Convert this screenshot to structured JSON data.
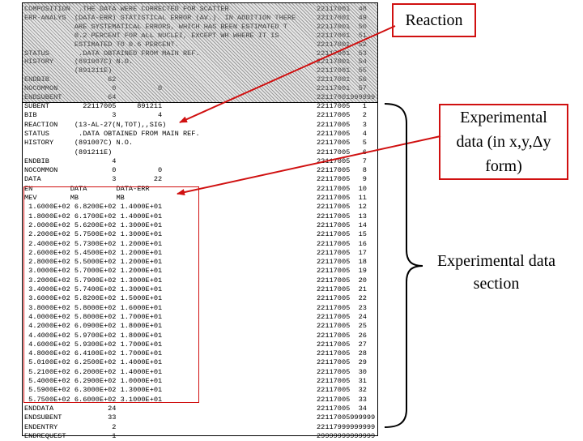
{
  "header_lines": [
    {
      "text": "COMPOSITION  .THE DATA WERE CORRECTED FOR SCATTER",
      "tag": "22117001  48"
    },
    {
      "text": "ERR-ANALYS  (DATA-ERR) STATISTICAL ERROR (AV.). IN ADDITION THERE",
      "tag": "22117001  49"
    },
    {
      "text": "            ARE SYSTEMATICAL ERRORS, WHICH HAS BEEN ESTIMATED T",
      "tag": "22117001  50"
    },
    {
      "text": "            0.2 PERCENT FOR ALL NUCLEI, EXCEPT WH WHERE IT IS",
      "tag": "22117001  51"
    },
    {
      "text": "            ESTIMATED TO 0.6 PERCENT.",
      "tag": "22117001  52"
    },
    {
      "text": "STATUS       .DATA OBTAINED FROM MAIN REF.",
      "tag": "22117001  53"
    },
    {
      "text": "HISTORY     (891007C) N.O.",
      "tag": "22117001  54"
    },
    {
      "text": "            (891211E)",
      "tag": "22117001  55"
    },
    {
      "text": "ENDBIB              62",
      "tag": "22117001  56"
    },
    {
      "text": "NOCOMMON             0          0",
      "tag": "22117001  57"
    },
    {
      "text": "ENDSUBENT           64",
      "tag": "22117001999999"
    }
  ],
  "body_lines": [
    {
      "text": "SUBENT        22117005     891211",
      "tag": "22117005   1"
    },
    {
      "text": "BIB                  3          4",
      "tag": "22117005   2"
    },
    {
      "text": "REACTION    (13-AL-27(N,TOT),,SIG)",
      "tag": "22117005   3"
    },
    {
      "text": "STATUS       .DATA OBTAINED FROM MAIN REF.",
      "tag": "22117005   4"
    },
    {
      "text": "HISTORY     (891007C) N.O.",
      "tag": "22117005   5"
    },
    {
      "text": "            (891211E)",
      "tag": "22117005   6"
    },
    {
      "text": "ENDBIB               4",
      "tag": "22117005   7"
    },
    {
      "text": "NOCOMMON             0          0",
      "tag": "22117005   8"
    },
    {
      "text": "DATA                 3         22",
      "tag": "22117005   9"
    },
    {
      "text": "EN         DATA       DATA-ERR",
      "tag": "22117005  10"
    },
    {
      "text": "MEV        MB         MB",
      "tag": "22117005  11"
    },
    {
      "text": " 1.6000E+02 6.8200E+02 1.4000E+01",
      "tag": "22117005  12"
    },
    {
      "text": " 1.8000E+02 6.1700E+02 1.4000E+01",
      "tag": "22117005  13"
    },
    {
      "text": " 2.0000E+02 5.6200E+02 1.3000E+01",
      "tag": "22117005  14"
    },
    {
      "text": " 2.2000E+02 5.7500E+02 1.3000E+01",
      "tag": "22117005  15"
    },
    {
      "text": " 2.4000E+02 5.7300E+02 1.2000E+01",
      "tag": "22117005  16"
    },
    {
      "text": " 2.6000E+02 5.4500E+02 1.2000E+01",
      "tag": "22117005  17"
    },
    {
      "text": " 2.8000E+02 5.5000E+02 1.2000E+01",
      "tag": "22117005  18"
    },
    {
      "text": " 3.0000E+02 5.7000E+02 1.2000E+01",
      "tag": "22117005  19"
    },
    {
      "text": " 3.2000E+02 5.7900E+02 1.3000E+01",
      "tag": "22117005  20"
    },
    {
      "text": " 3.4000E+02 5.7400E+02 1.3000E+01",
      "tag": "22117005  21"
    },
    {
      "text": " 3.6000E+02 5.8200E+02 1.5000E+01",
      "tag": "22117005  22"
    },
    {
      "text": " 3.8000E+02 5.8000E+02 1.6000E+01",
      "tag": "22117005  23"
    },
    {
      "text": " 4.0000E+02 5.8000E+02 1.7000E+01",
      "tag": "22117005  24"
    },
    {
      "text": " 4.2000E+02 6.0900E+02 1.8000E+01",
      "tag": "22117005  25"
    },
    {
      "text": " 4.4000E+02 5.9700E+02 1.8000E+01",
      "tag": "22117005  26"
    },
    {
      "text": " 4.6000E+02 5.9300E+02 1.7000E+01",
      "tag": "22117005  27"
    },
    {
      "text": " 4.8000E+02 6.4100E+02 1.7000E+01",
      "tag": "22117005  28"
    },
    {
      "text": " 5.0100E+02 6.2500E+02 1.4000E+01",
      "tag": "22117005  29"
    },
    {
      "text": " 5.2100E+02 6.2000E+02 1.4000E+01",
      "tag": "22117005  30"
    },
    {
      "text": " 5.4000E+02 6.2900E+02 1.0000E+01",
      "tag": "22117005  31"
    },
    {
      "text": " 5.5900E+02 6.3000E+02 1.3000E+01",
      "tag": "22117005  32"
    },
    {
      "text": " 5.7500E+02 6.6000E+02 3.1000E+01",
      "tag": "22117005  33"
    },
    {
      "text": "ENDDATA             24",
      "tag": "22117005  34"
    },
    {
      "text": "ENDSUBENT           33",
      "tag": "22117005999999"
    },
    {
      "text": "ENDENTRY             2",
      "tag": "22117999999999"
    },
    {
      "text": "ENDREQUEST           1",
      "tag": "29999999999999"
    }
  ],
  "annotations": {
    "reaction_label": "Reaction",
    "experimental_data_label": "Experimental data (in x,y,Δy form)",
    "experimental_section_label": "Experimental data section"
  },
  "colors": {
    "annotation_red": "#d01010",
    "text": "#000000"
  }
}
